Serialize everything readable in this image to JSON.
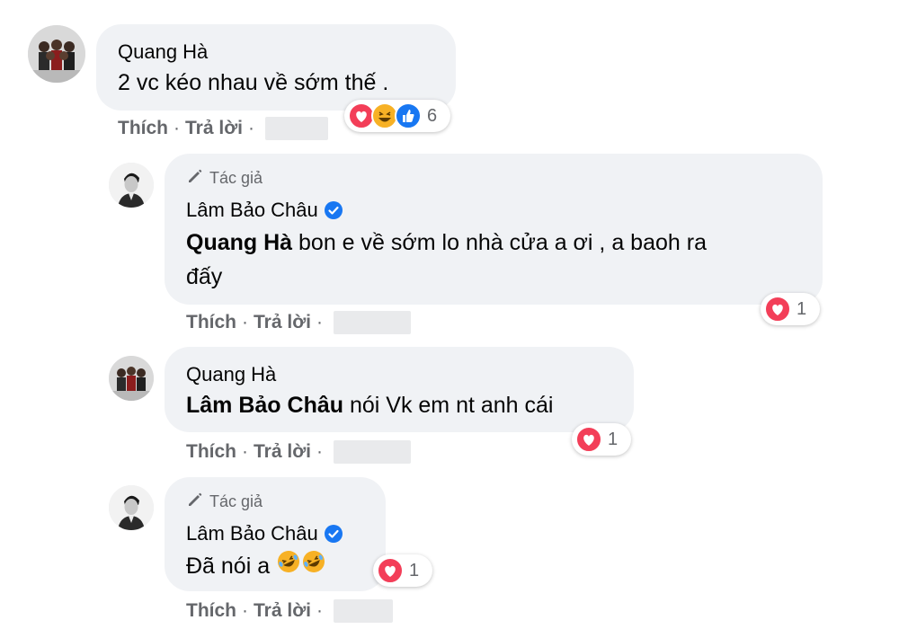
{
  "actions": {
    "like": "Thích",
    "reply": "Trả lời",
    "separator": "·"
  },
  "author_tag": "Tác giả",
  "comments": [
    {
      "avatar": "group-photo-avatar",
      "name": "Quang Hà",
      "verified": false,
      "text": "2 vc kéo nhau về sớm thế .",
      "reaction_icons": [
        "love-icon",
        "haha-icon",
        "like-icon"
      ],
      "reaction_count": "6"
    },
    {
      "avatar": "man-portrait-avatar",
      "author": true,
      "name": "Lâm Bảo Châu",
      "verified": true,
      "mention": "Quang Hà",
      "text_line1": " bon e về sớm lo nhà cửa a ơi , a baoh ra",
      "text_line2": "đấy",
      "reaction_icons": [
        "love-icon"
      ],
      "reaction_count": "1"
    },
    {
      "avatar": "group-photo-avatar",
      "name": "Quang Hà",
      "verified": false,
      "mention": "Lâm Bảo Châu",
      "text": " nói Vk em nt anh cái",
      "reaction_icons": [
        "love-icon"
      ],
      "reaction_count": "1"
    },
    {
      "avatar": "man-portrait-avatar",
      "author": true,
      "name": "Lâm Bảo Châu",
      "verified": true,
      "text": "Đã nói a",
      "emoji": [
        "rolling-laughing-emoji",
        "rolling-laughing-emoji"
      ],
      "reaction_icons": [
        "love-icon"
      ],
      "reaction_count": "1"
    }
  ],
  "colors": {
    "bubble": "#f0f2f5",
    "secondary_text": "#65676b",
    "love": "#f33e58",
    "like": "#1877f2",
    "haha": "#f7b125",
    "verified": "#1877f2"
  }
}
